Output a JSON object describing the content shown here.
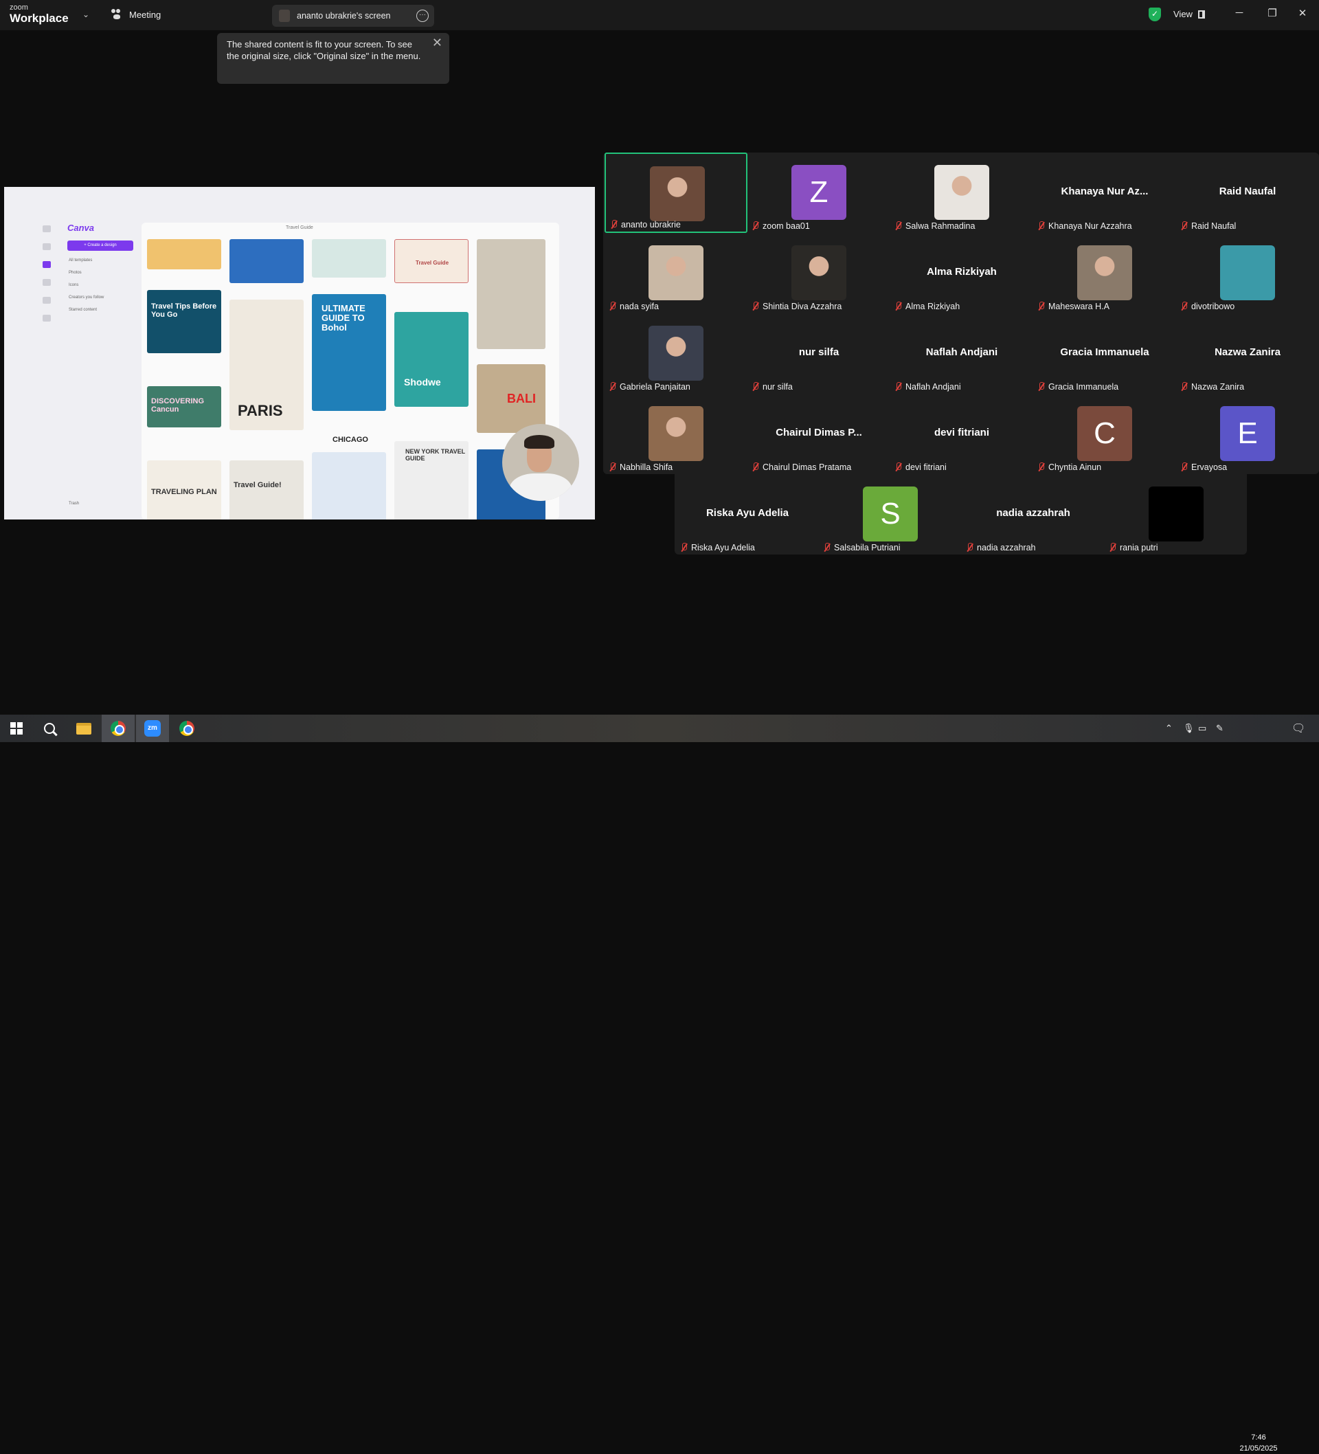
{
  "titlebar": {
    "brand_top": "zoom",
    "brand_bottom": "Workplace",
    "meeting_label": "Meeting",
    "share_label": "ananto ubrakrie's screen",
    "view_label": "View"
  },
  "tooltip": {
    "text": "The shared content is fit to your screen. To see the original size, click \"Original size\" in the menu."
  },
  "shared_screen": {
    "app_logo": "Canva",
    "create_button": "+ Create a design",
    "search_placeholder": "Travel Guide",
    "nav_items": [
      "All templates",
      "Photos",
      "Icons",
      "Creators you follow",
      "Starred content"
    ],
    "trash": "Trash",
    "cards": {
      "travel_tips": "Travel Tips Before You Go",
      "ultimate": "ULTIMATE GUIDE TO Bohol",
      "discovering": "DISCOVERING Cancun",
      "paris": "PARIS",
      "shodwe": "Shodwe",
      "chicago": "CHICAGO",
      "new_york": "NEW YORK TRAVEL GUIDE",
      "bali": "BALI",
      "traveling_plan": "TRAVELING PLAN",
      "travel_guide_small": "Travel Guide",
      "travel_guide_card": "Travel Guide!"
    }
  },
  "participants": [
    {
      "name": "ananto ubrakrie",
      "kind": "photo",
      "color": "#6b4a3a",
      "active": true
    },
    {
      "name": "zoom baa01",
      "kind": "letter",
      "letter": "Z",
      "color": "#8a4fc2"
    },
    {
      "name": "Salwa Rahmadina",
      "kind": "photo",
      "color": "#e8e4df"
    },
    {
      "name": "Khanaya Nur Azzahra",
      "kind": "text",
      "display": "Khanaya Nur Az..."
    },
    {
      "name": "Raid Naufal",
      "kind": "text",
      "display": "Raid Naufal"
    },
    {
      "name": "nada syifa",
      "kind": "photo",
      "color": "#c9b8a5"
    },
    {
      "name": "Shintia Diva Azzahra",
      "kind": "photo",
      "color": "#2b2926"
    },
    {
      "name": "Alma Rizkiyah",
      "kind": "text",
      "display": "Alma Rizkiyah"
    },
    {
      "name": "Maheswara H.A",
      "kind": "photo",
      "color": "#8a7a6a"
    },
    {
      "name": "divotribowo",
      "kind": "solid",
      "color": "#3b9aa8"
    },
    {
      "name": "Gabriela Panjaitan",
      "kind": "photo",
      "color": "#3a3f4d"
    },
    {
      "name": "nur silfa",
      "kind": "text",
      "display": "nur silfa"
    },
    {
      "name": "Naflah Andjani",
      "kind": "text",
      "display": "Naflah Andjani"
    },
    {
      "name": "Gracia Immanuela",
      "kind": "text",
      "display": "Gracia Immanuela"
    },
    {
      "name": "Nazwa Zanira",
      "kind": "text",
      "display": "Nazwa Zanira"
    },
    {
      "name": "Nabhilla Shifa",
      "kind": "photo",
      "color": "#8e6a4e"
    },
    {
      "name": "Chairul Dimas Pratama",
      "kind": "text",
      "display": "Chairul Dimas P..."
    },
    {
      "name": "devi fitriani",
      "kind": "text",
      "display": "devi fitriani"
    },
    {
      "name": "Chyntia Ainun",
      "kind": "letter",
      "letter": "C",
      "color": "#7a4a3c"
    },
    {
      "name": "Ervayosa",
      "kind": "letter",
      "letter": "E",
      "color": "#5b55c8"
    },
    {
      "name": "Riska Ayu Adelia",
      "kind": "text",
      "display": "Riska Ayu Adelia"
    },
    {
      "name": "Salsabila Putriani",
      "kind": "letter",
      "letter": "S",
      "color": "#6aaa3a"
    },
    {
      "name": "nadia azzahrah",
      "kind": "text",
      "display": "nadia azzahrah"
    },
    {
      "name": "rania putri",
      "kind": "solid",
      "color": "#000000"
    }
  ],
  "taskbar": {
    "zoom_icon_text": "zm",
    "time": "7:46",
    "date": "21/05/2025"
  }
}
